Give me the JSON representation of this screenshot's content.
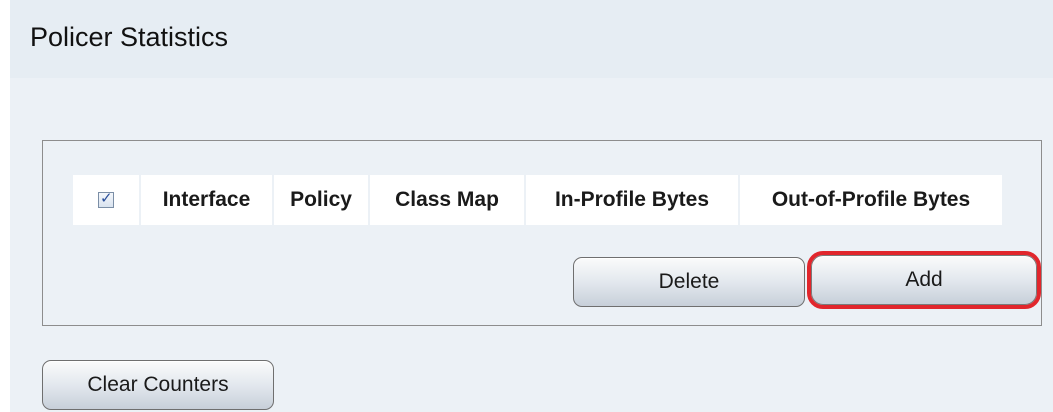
{
  "page": {
    "title": "Policer Statistics"
  },
  "table": {
    "header_checkbox_checked": true,
    "columns": [
      "Interface",
      "Policy",
      "Class Map",
      "In-Profile Bytes",
      "Out-of-Profile Bytes"
    ]
  },
  "actions": {
    "delete_label": "Delete",
    "add_label": "Add",
    "clear_counters_label": "Clear Counters"
  },
  "colors": {
    "highlight": "#e1262c",
    "title_bar_bg": "#e6edf3",
    "content_bg": "#ecf1f6"
  }
}
